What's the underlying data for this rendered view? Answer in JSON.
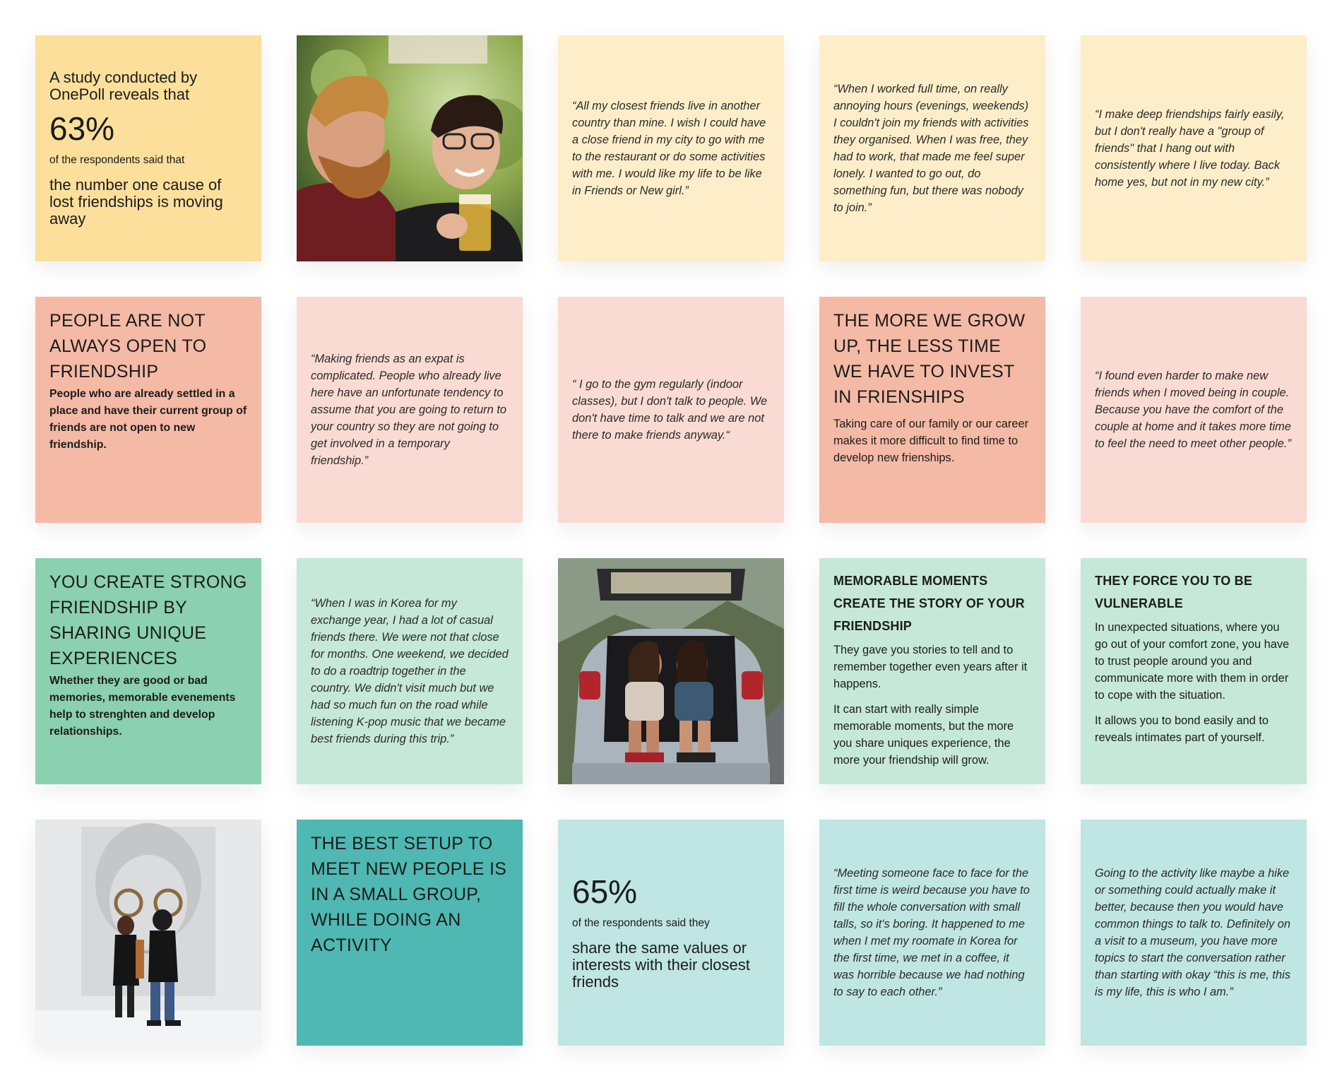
{
  "cards": {
    "stat1": {
      "intro": "A study conducted by OnePoll reveals that",
      "percent": "63%",
      "small": "of the respondents said that",
      "main": "the number one cause of lost friendships is moving away"
    },
    "quote_restaurant": "“All my closest friends live in another country than mine. I wish I could have a close friend in my city to go with me to the restaurant or do some activities with me. I would like my life to be like in Friends or New girl.”",
    "quote_fulltime": "“When I worked full time, on really annoying hours (evenings, weekends) I couldn't join my friends with activities they organised. When I was free, they had to work, that made me feel super lonely. I wanted to go out, do something fun, but there was nobody to join.”",
    "quote_deep": "“I make deep friendships fairly easily, but I don't really have a \"group of friends\" that I hang out with consistently where I live today. Back home yes, but not in my new city.”",
    "not_open": {
      "title": "PEOPLE ARE NOT ALWAYS OPEN TO FRIENDSHIP",
      "body": "People who are already settled in a place and have their current group of friends are not open to new friendship."
    },
    "quote_expat": "“Making friends as an expat is complicated. People who already live here have an unfortunate tendency to assume that you are going to return to your country so they are not going to get involved in a temporary friendship.”",
    "quote_gym": "“ I go to the gym regularly (indoor classes), but I don't talk to people. We don't have time to talk and we are not there to make friends anyway.“",
    "grow_up": {
      "title": "THE MORE WE GROW UP, THE LESS TIME WE HAVE TO INVEST IN FRIENSHIPS",
      "body": "Taking care of our family or our career makes it more difficult to find time to develop new frienships."
    },
    "quote_couple": "“I found even harder to make new friends when I moved being in couple. Because you have the comfort of the couple at home and it takes more time to feel the need to meet other people.”",
    "strong": {
      "title": "YOU CREATE STRONG FRIENDSHIP BY SHARING UNIQUE EXPERIENCES",
      "body": "Whether they are good or bad memories, memorable evenements help to strenghten and develop relationships."
    },
    "quote_korea": "“When I was in Korea for my exchange year, I had a lot of casual friends there. We were not that close for months. One weekend, we decided to do a roadtrip together in the country. We didn't visit much but we had so much fun on the road while listening K-pop music that we became best friends during this trip.”",
    "memorable": {
      "title": "MEMORABLE MOMENTS CREATE THE STORY OF YOUR FRIENDSHIP",
      "body1": "They gave you stories to tell and to remember together even years after it happens.",
      "body2": "It can start with really simple memorable moments, but the more you share uniques experience, the more your friendship will grow."
    },
    "vulnerable": {
      "title": "THEY FORCE YOU TO BE VULNERABLE",
      "body1": "In unexpected situations, where you go out of your comfort zone, you have to trust people around you and communicate more with them in order to cope with the situation.",
      "body2": "It allows you to bond easily and to reveals intimates part of yourself."
    },
    "setup": {
      "title": "THE BEST SETUP TO MEET NEW PEOPLE IS IN A SMALL GROUP, WHILE DOING AN ACTIVITY"
    },
    "stat2": {
      "percent": "65%",
      "small": "of the respondents said they",
      "main": "share the same values or interests with their closest friends"
    },
    "quote_face": "“Meeting someone face to face for the first time is weird because you have to fill the whole conversation with small talls, so it's boring. It happened to me when I met my roomate in Korea for the first time, we met in a coffee, it was horrible because we had nothing to say to each other.”",
    "quote_hike": "Going to the activity like maybe a hike or something could actually make it better, because then you would have common things to talk to. Definitely on a visit to a museum, you have more topics to start the conversation rather than starting with okay “this is me, this is my life, this is who I am.”"
  },
  "colors": {
    "yellow_strong": "#fbdf9b",
    "yellow": "#fdeec9",
    "salmon": "#f4baa6",
    "pink": "#f9dbd3",
    "green_strong": "#8bd0b0",
    "green": "#c5e8d9",
    "teal_strong": "#4fb8b2",
    "teal": "#bfe6e2"
  },
  "photos": [
    "two-men-cheers-photo",
    "two-women-car-trunk-photo",
    "couple-museum-portrait-photo"
  ]
}
